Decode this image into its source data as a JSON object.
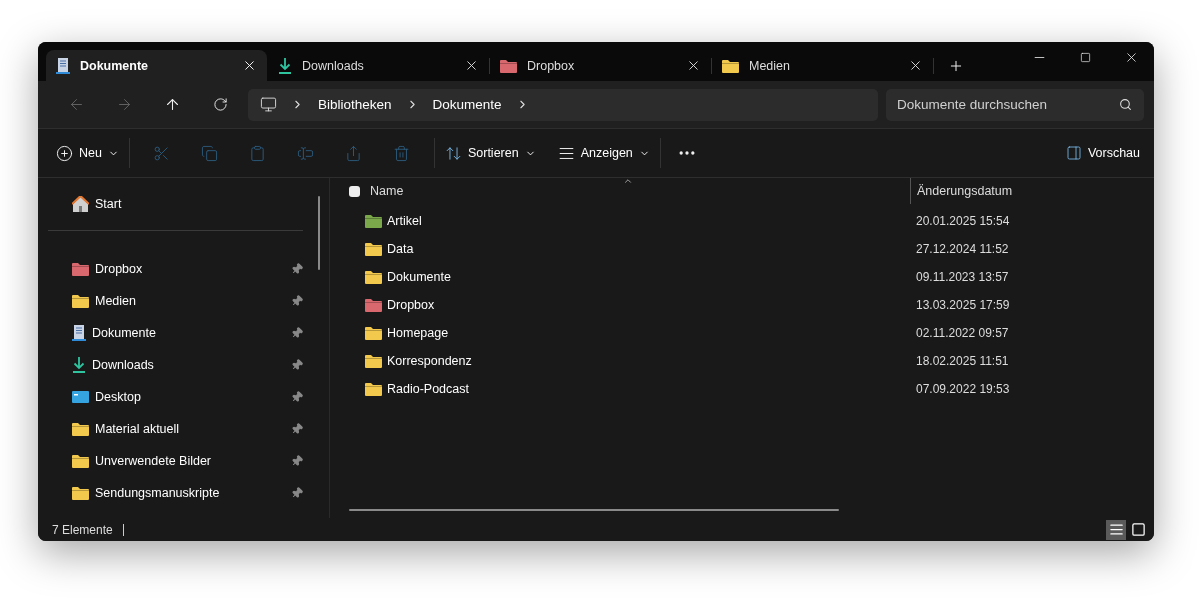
{
  "tabs": [
    {
      "label": "Dokumente",
      "kind": "document",
      "selected": true
    },
    {
      "label": "Downloads",
      "kind": "download",
      "selected": false
    },
    {
      "label": "Dropbox",
      "kind": "folder",
      "color": "#d9686e",
      "selected": false
    },
    {
      "label": "Medien",
      "kind": "folder",
      "color": "#f2c94c",
      "selected": false
    }
  ],
  "breadcrumb": [
    "Bibliotheken",
    "Dokumente"
  ],
  "search": {
    "placeholder": "Dokumente durchsuchen"
  },
  "toolbar": {
    "new_label": "Neu",
    "actions": [
      {
        "kind": "cut",
        "disabled": true
      },
      {
        "kind": "copy",
        "disabled": true
      },
      {
        "kind": "paste",
        "disabled": true
      },
      {
        "kind": "rename",
        "disabled": true
      },
      {
        "kind": "share",
        "disabled": true
      },
      {
        "kind": "delete",
        "disabled": true
      }
    ],
    "sort_label": "Sortieren",
    "view_label": "Anzeigen",
    "preview_label": "Vorschau"
  },
  "sidebar": {
    "start": {
      "label": "Start"
    },
    "items": [
      {
        "label": "Dropbox",
        "kind": "folder",
        "color": "#d9686e",
        "pinned": true
      },
      {
        "label": "Medien",
        "kind": "folder",
        "color": "#f2c94c",
        "pinned": true
      },
      {
        "label": "Dokumente",
        "kind": "document",
        "pinned": true
      },
      {
        "label": "Downloads",
        "kind": "download",
        "pinned": true
      },
      {
        "label": "Desktop",
        "kind": "desktop",
        "pinned": true
      },
      {
        "label": "Material aktuell",
        "kind": "folder",
        "color": "#f2c94c",
        "pinned": true
      },
      {
        "label": "Unverwendete Bilder",
        "kind": "folder",
        "color": "#f2c94c",
        "pinned": true
      },
      {
        "label": "Sendungsmanuskripte",
        "kind": "folder",
        "color": "#f2c94c",
        "pinned": true
      }
    ]
  },
  "table": {
    "columns": [
      "Name",
      "Änderungsdatum"
    ],
    "select_all": {
      "checked": false
    },
    "rows": [
      {
        "name": "Artikel",
        "date": "20.01.2025 15:54",
        "color": "#7aa84a"
      },
      {
        "name": "Data",
        "date": "27.12.2024 11:52",
        "color": "#f2c94c"
      },
      {
        "name": "Dokumente",
        "date": "09.11.2023 13:57",
        "color": "#f2c94c"
      },
      {
        "name": "Dropbox",
        "date": "13.03.2025 17:59",
        "color": "#d9686e"
      },
      {
        "name": "Homepage",
        "date": "02.11.2022 09:57",
        "color": "#f2c94c"
      },
      {
        "name": "Korrespondenz",
        "date": "18.02.2025 11:51",
        "color": "#f2c94c"
      },
      {
        "name": "Radio-Podcast",
        "date": "07.09.2022 19:53",
        "color": "#f2c94c"
      }
    ]
  },
  "status_bar": {
    "count": "7 Elemente",
    "views": [
      {
        "kind": "details",
        "selected": true
      },
      {
        "kind": "tiles",
        "selected": false
      }
    ]
  }
}
